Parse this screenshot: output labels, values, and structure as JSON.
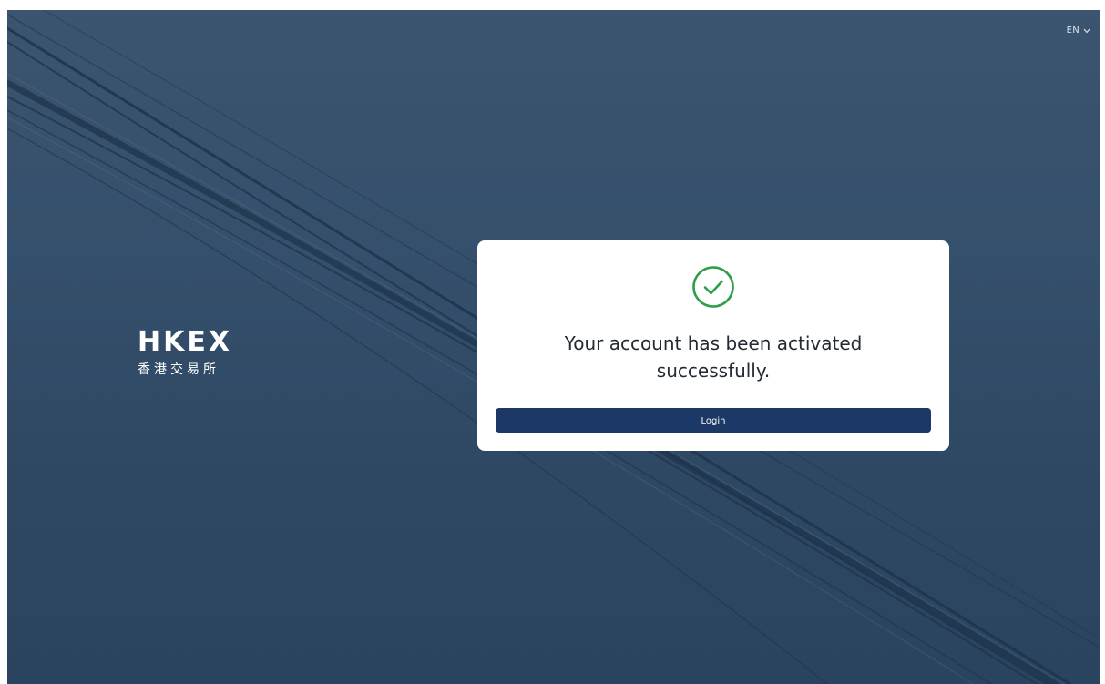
{
  "header": {
    "language": "EN"
  },
  "logo": {
    "name_en": "HKEX",
    "name_zh": "香港交易所"
  },
  "dialog": {
    "icon": "check-circle-icon",
    "message": "Your account has been activated successfully.",
    "login_label": "Login"
  },
  "colors": {
    "background": "#34506c",
    "card": "#ffffff",
    "button": "#1c3866",
    "success": "#2e9e4a"
  }
}
